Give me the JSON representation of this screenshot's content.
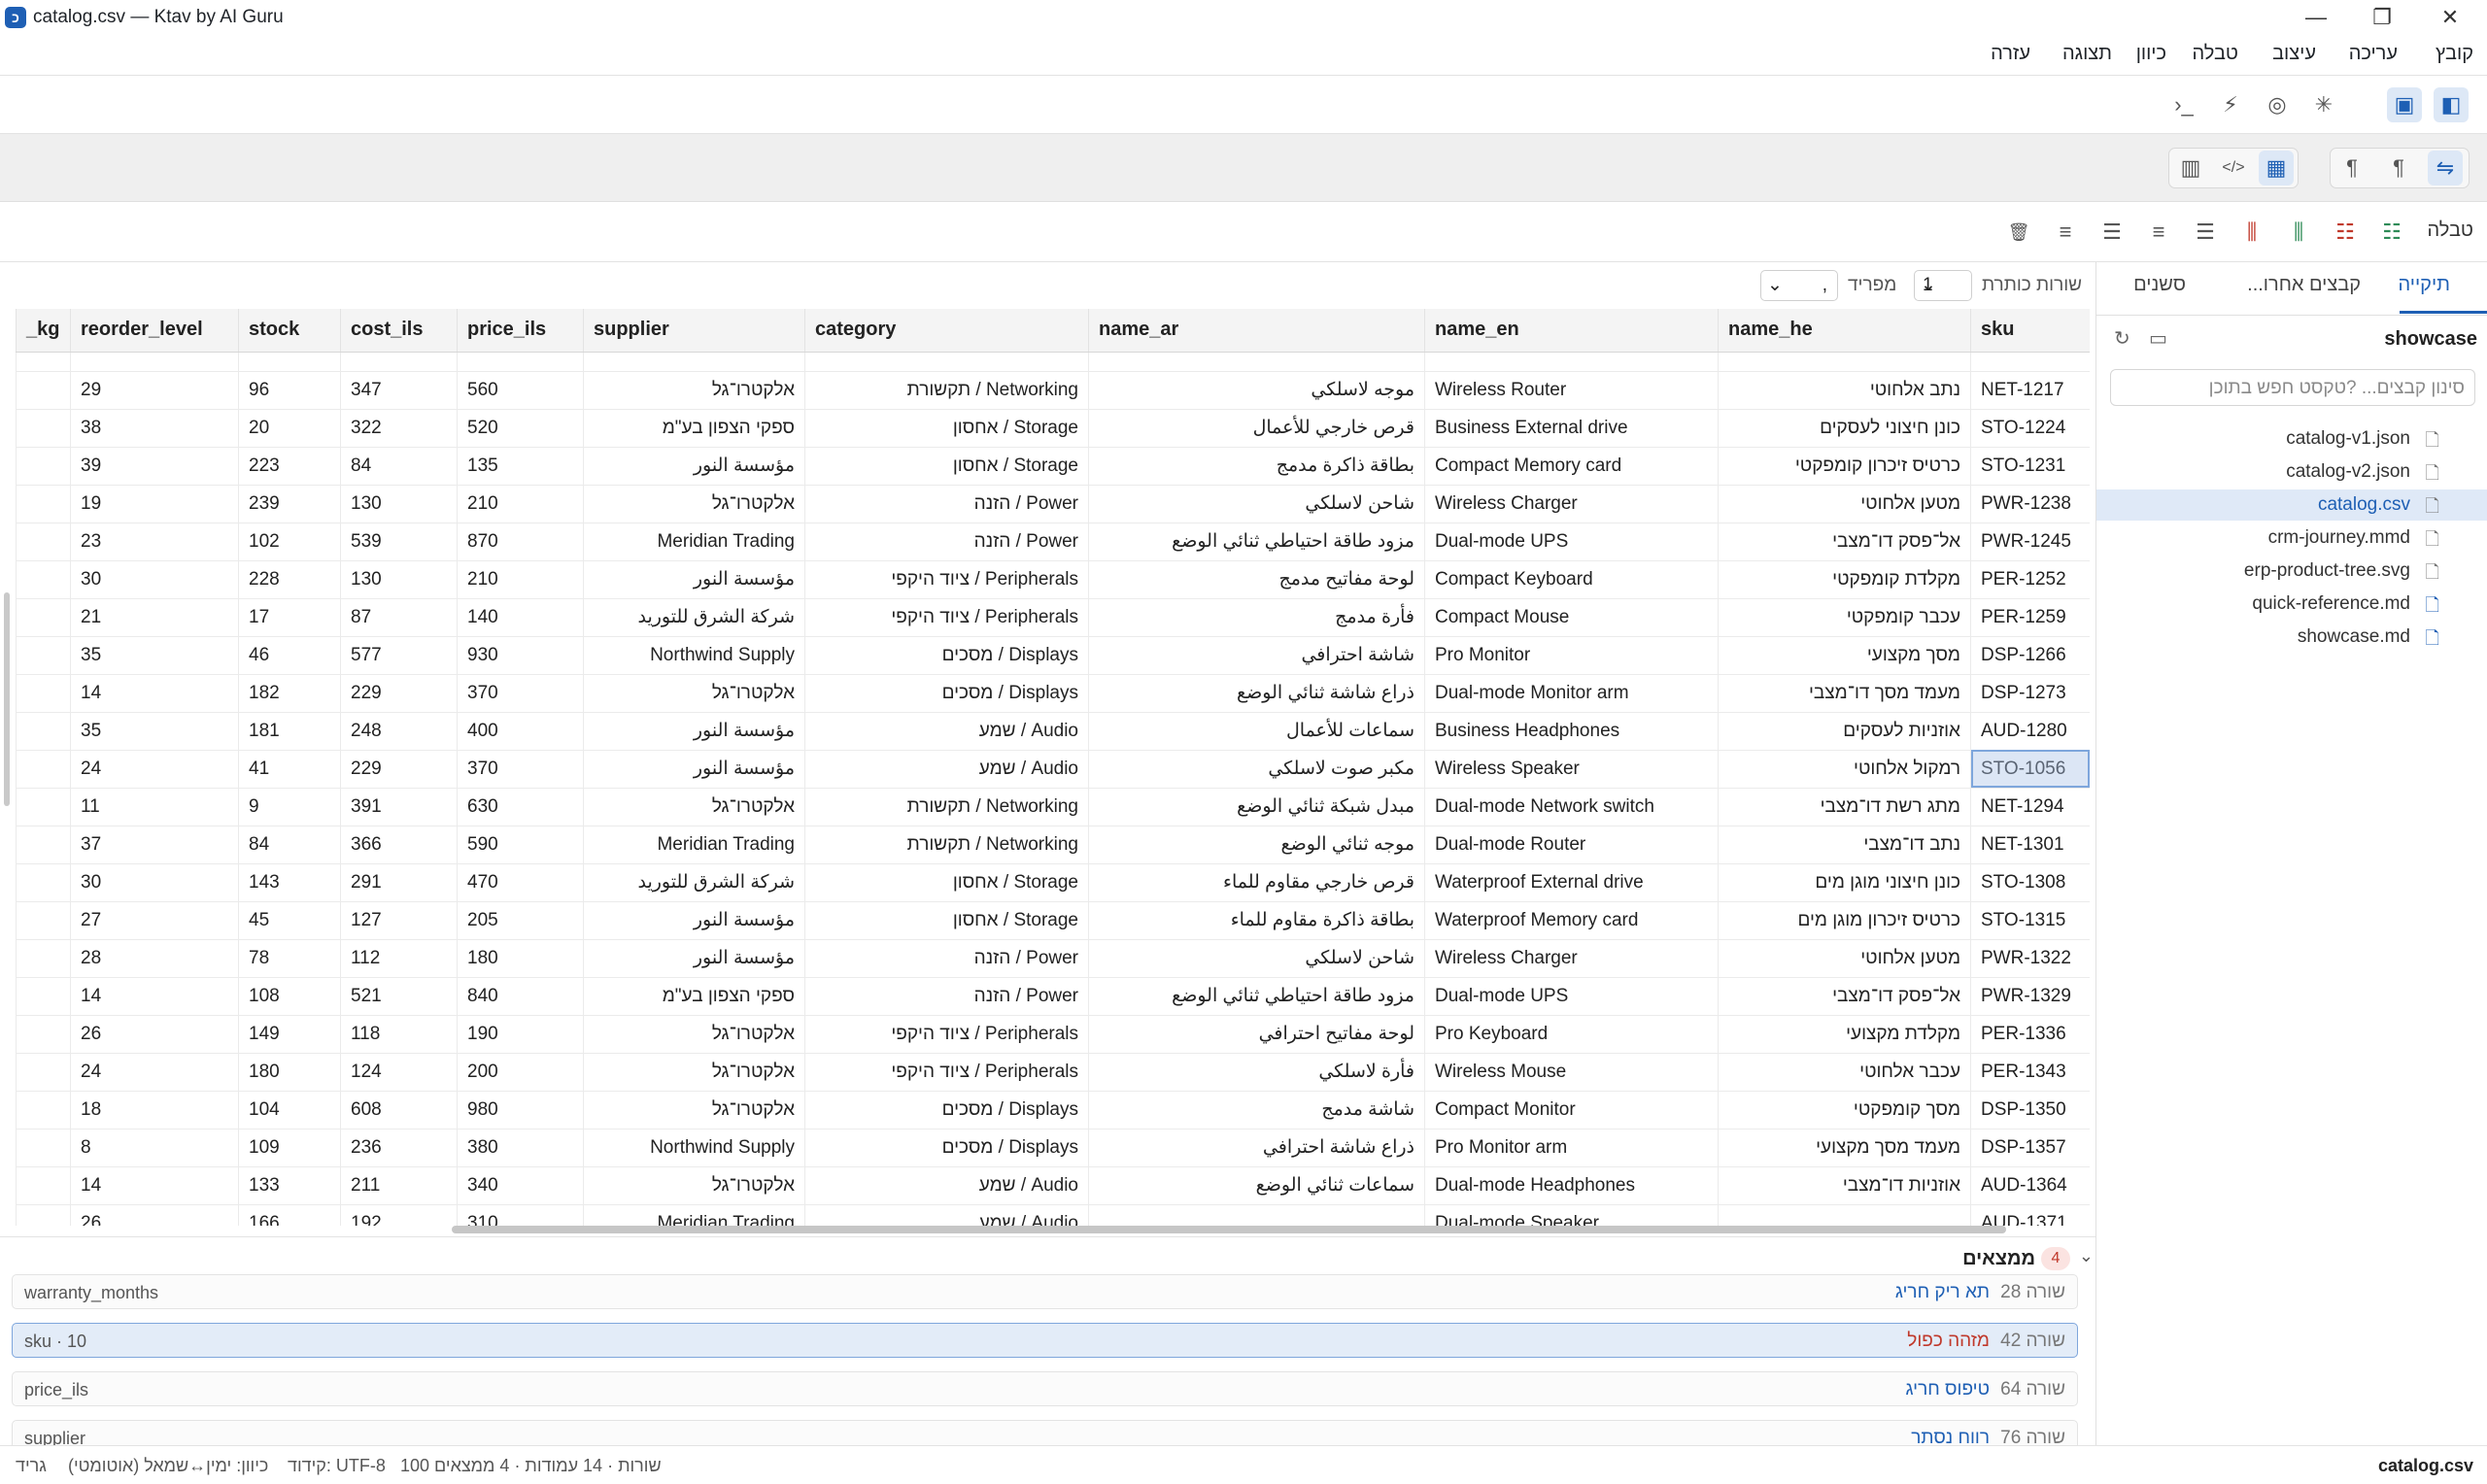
{
  "window": {
    "title": "catalog.csv — Ktav by AI Guru",
    "app_icon_glyph": "כ",
    "controls": [
      "—",
      "❐",
      "✕"
    ]
  },
  "menu": [
    "קובץ",
    "עריכה",
    "עיצוב",
    "טבלה",
    "כיוון",
    "תצוגה",
    "עזרה"
  ],
  "toolbar3": {
    "label": "טבלה"
  },
  "grid_options": {
    "header_rows_label": "שורות כותרת",
    "header_rows_value": "1",
    "delimiter_label": "מפריד",
    "delimiter_value": ","
  },
  "table": {
    "columns": [
      "_kg",
      "reorder_level",
      "stock",
      "cost_ils",
      "price_ils",
      "supplier",
      "category",
      "name_ar",
      "name_en",
      "name_he",
      "sku"
    ],
    "top_partial_row": [
      "",
      "",
      "",
      "",
      "",
      "",
      "",
      "",
      "",
      "",
      ""
    ],
    "rows": [
      [
        "",
        "29",
        "96",
        "347",
        "560",
        "אלקטרו־גל",
        "Networking / תקשורת",
        "موجه لاسلكي",
        "Wireless Router",
        "נתב אלחוטי",
        "NET-1217"
      ],
      [
        "",
        "38",
        "20",
        "322",
        "520",
        "ספקי הצפון בע\"מ",
        "Storage / אחסון",
        "قرص خارجي للأعمال",
        "Business External drive",
        "כונן חיצוני לעסקים",
        "STO-1224"
      ],
      [
        "",
        "39",
        "223",
        "84",
        "135",
        "مؤسسة النور",
        "Storage / אחסון",
        "بطاقة ذاكرة مدمج",
        "Compact Memory card",
        "כרטיס זיכרון קומפקטי",
        "STO-1231"
      ],
      [
        "",
        "19",
        "239",
        "130",
        "210",
        "אלקטרו־גל",
        "Power / הזנה",
        "شاحن لاسلكي",
        "Wireless Charger",
        "מטען אלחוטי",
        "PWR-1238"
      ],
      [
        "",
        "23",
        "102",
        "539",
        "870",
        "Meridian Trading",
        "Power / הזנה",
        "مزود طاقة احتياطي ثنائي الوضع",
        "Dual-mode UPS",
        "אל־פסק דו־מצבי",
        "PWR-1245"
      ],
      [
        "",
        "30",
        "228",
        "130",
        "210",
        "مؤسسة النور",
        "Peripherals / ציוד היקפי",
        "لوحة مفاتيح مدمج",
        "Compact Keyboard",
        "מקלדת קומפקטי",
        "PER-1252"
      ],
      [
        "",
        "21",
        "17",
        "87",
        "140",
        "شركة الشرق للتوريد",
        "Peripherals / ציוד היקפי",
        "فأرة مدمج",
        "Compact Mouse",
        "עכבר קומפקטי",
        "PER-1259"
      ],
      [
        "",
        "35",
        "46",
        "577",
        "930",
        "Northwind Supply",
        "Displays / מסכים",
        "شاشة احترافي",
        "Pro Monitor",
        "מסך מקצועי",
        "DSP-1266"
      ],
      [
        "",
        "14",
        "182",
        "229",
        "370",
        "אלקטרו־גל",
        "Displays / מסכים",
        "ذراع شاشة ثنائي الوضع",
        "Dual-mode Monitor arm",
        "מעמד מסך דו־מצבי",
        "DSP-1273"
      ],
      [
        "",
        "35",
        "181",
        "248",
        "400",
        "مؤسسة النور",
        "Audio / שמע",
        "سماعات للأعمال",
        "Business Headphones",
        "אוזניות לעסקים",
        "AUD-1280"
      ],
      [
        "",
        "24",
        "41",
        "229",
        "370",
        "مؤسسة النور",
        "Audio / שמע",
        "مكبر صوت لاسلكي",
        "Wireless Speaker",
        "רמקול אלחוטי",
        "STO-1056"
      ],
      [
        "",
        "11",
        "9",
        "391",
        "630",
        "אלקטרו־גל",
        "Networking / תקשורת",
        "مبدل شبكة ثنائي الوضع",
        "Dual-mode Network switch",
        "מתג רשת דו־מצבי",
        "NET-1294"
      ],
      [
        "",
        "37",
        "84",
        "366",
        "590",
        "Meridian Trading",
        "Networking / תקשורת",
        "موجه ثنائي الوضع",
        "Dual-mode Router",
        "נתב דו־מצבי",
        "NET-1301"
      ],
      [
        "",
        "30",
        "143",
        "291",
        "470",
        "شركة الشرق للتوريد",
        "Storage / אחסון",
        "قرص خارجي مقاوم للماء",
        "Waterproof External drive",
        "כונן חיצוני מוגן מים",
        "STO-1308"
      ],
      [
        "",
        "27",
        "45",
        "127",
        "205",
        "مؤسسة النور",
        "Storage / אחסון",
        "بطاقة ذاكرة مقاوم للماء",
        "Waterproof Memory card",
        "כרטיס זיכרון מוגן מים",
        "STO-1315"
      ],
      [
        "",
        "28",
        "78",
        "112",
        "180",
        "مؤسسة النور",
        "Power / הזנה",
        "شاحن لاسلكي",
        "Wireless Charger",
        "מטען אלחוטי",
        "PWR-1322"
      ],
      [
        "",
        "14",
        "108",
        "521",
        "840",
        "ספקי הצפון בע\"מ",
        "Power / הזנה",
        "مزود طاقة احتياطي ثنائي الوضع",
        "Dual-mode UPS",
        "אל־פסק דו־מצבי",
        "PWR-1329"
      ],
      [
        "",
        "26",
        "149",
        "118",
        "190",
        "אלקטרו־גל",
        "Peripherals / ציוד היקפי",
        "لوحة مفاتيح احترافي",
        "Pro Keyboard",
        "מקלדת מקצועי",
        "PER-1336"
      ],
      [
        "",
        "24",
        "180",
        "124",
        "200",
        "אלקטרו־גל",
        "Peripherals / ציוד היקפי",
        "فأرة لاسلكي",
        "Wireless Mouse",
        "עכבר אלחוטי",
        "PER-1343"
      ],
      [
        "",
        "18",
        "104",
        "608",
        "980",
        "אלקטרו־גל",
        "Displays / מסכים",
        "شاشة مدمج",
        "Compact Monitor",
        "מסך קומפקטי",
        "DSP-1350"
      ],
      [
        "",
        "8",
        "109",
        "236",
        "380",
        "Northwind Supply",
        "Displays / מסכים",
        "ذراع شاشة احترافي",
        "Pro Monitor arm",
        "מעמד מסך מקצועי",
        "DSP-1357"
      ],
      [
        "",
        "14",
        "133",
        "211",
        "340",
        "אלקטרו־גל",
        "Audio / שמע",
        "سماعات ثنائي الوضع",
        "Dual-mode Headphones",
        "אוזניות דו־מצבי",
        "AUD-1364"
      ],
      [
        "",
        "26",
        "166",
        "192",
        "310",
        "Meridian Trading",
        "Audio / שמע",
        "",
        "Dual-mode Speaker",
        "",
        "AUD-1371"
      ]
    ],
    "selected_cell": "STO-1056"
  },
  "findings": {
    "title": "ממצאים",
    "count": "4",
    "items": [
      {
        "row": "שורה 28",
        "type": "תא ריק חריג",
        "type_color": "#1e5fb4",
        "column": "warranty_months"
      },
      {
        "row": "שורה 42",
        "type": "מזהה כפול",
        "type_color": "#c0392b",
        "column": "sku · 10"
      },
      {
        "row": "שורה 64",
        "type": "טיפוס חריג",
        "type_color": "#1e5fb4",
        "column": "price_ils"
      },
      {
        "row": "שורה 76",
        "type": "רווח נסתר",
        "type_color": "#1e5fb4",
        "column": "supplier"
      }
    ]
  },
  "statusbar": {
    "file": "catalog.csv",
    "summary": "100 שורות · 14 עמודות · 4 ממצאים",
    "encoding": "קידוד: UTF-8",
    "direction": "כיוון: ימין↔שמאל (אוטומטי)",
    "view": "גריד"
  },
  "sidebar": {
    "tabs": [
      "תיקייה",
      "קבצים אחרו...",
      "סשנים"
    ],
    "workspace": "showcase",
    "filter_placeholder": "סינון קבצים... ?טקסט חפש בתוכן",
    "files": [
      {
        "name": "catalog-v1.json",
        "kind": "file"
      },
      {
        "name": "catalog-v2.json",
        "kind": "file"
      },
      {
        "name": "catalog.csv",
        "kind": "file",
        "active": true
      },
      {
        "name": "crm-journey.mmd",
        "kind": "file"
      },
      {
        "name": "erp-product-tree.svg",
        "kind": "file"
      },
      {
        "name": "quick-reference.md",
        "kind": "md"
      },
      {
        "name": "showcase.md",
        "kind": "md"
      }
    ]
  },
  "icons": {
    "terminal": "›_",
    "bolt": "⚡",
    "target": "◎",
    "sparkle": "✳",
    "console": "▣",
    "sidebar": "◧",
    "split": "▥",
    "code": "</>",
    "grid": "▦",
    "pilcrow_l": "¶",
    "pilcrow_r": "¶",
    "dir": "⇋",
    "trash": "🗑",
    "align_justify": "≡",
    "align_right": "☰",
    "align_center": "≡",
    "align_left": "☰",
    "del_col": "⫼",
    "add_col": "⫼",
    "del_row": "☷",
    "add_row": "☷",
    "refresh": "↻",
    "folder": "▭",
    "chevron_down": "⌄"
  }
}
